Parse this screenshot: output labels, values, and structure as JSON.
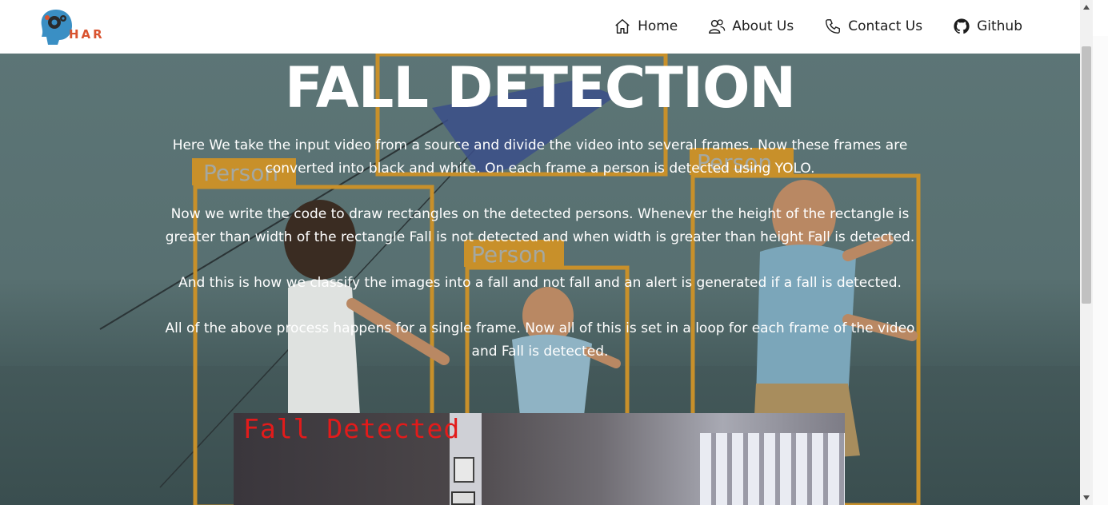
{
  "logo": {
    "text": "HAR",
    "icon": "brain-gear-icon"
  },
  "nav": [
    {
      "label": "Home",
      "icon": "home-icon"
    },
    {
      "label": "About Us",
      "icon": "users-icon"
    },
    {
      "label": "Contact Us",
      "icon": "phone-icon"
    },
    {
      "label": "Github",
      "icon": "github-icon"
    }
  ],
  "hero": {
    "title": "FALL DETECTION",
    "paragraphs": [
      "Here We take the input video from a source and divide the video into several frames. Now these frames are converted into black and white. On each frame a person is detected using YOLO.",
      "Now we write the code to draw rectangles on the detected persons. Whenever the height of the rectangle is greater than width of the rectangle Fall is not detected and when width is greater than height Fall is detected.",
      "And this is how we classify the images into a fall and not fall and an alert is generated if a fall is detected.",
      "All of the above process happens for a single frame. Now all of this is set in a loop for each frame of the video and Fall is detected."
    ]
  },
  "background": {
    "person_labels": [
      "Person",
      "Person",
      "Person"
    ],
    "box_color": "#c8902a"
  },
  "video": {
    "overlay_text": "Fall Detected",
    "overlay_color": "#e21b1b"
  },
  "colors": {
    "header_bg": "#ffffff",
    "logo_accent": "#d9532f",
    "logo_blue": "#3a8fc4"
  }
}
